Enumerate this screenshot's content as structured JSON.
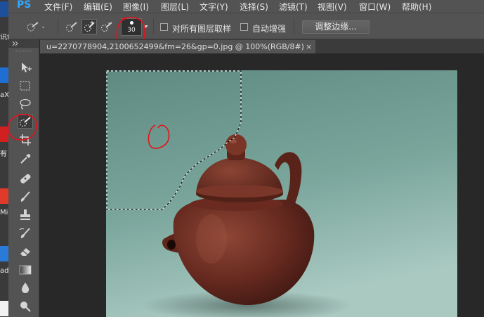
{
  "app": {
    "logo": "PS"
  },
  "desktop_strip": {
    "fragments": [
      "讯f",
      "aX",
      "有",
      "Mi",
      "ad"
    ]
  },
  "menu": {
    "items": [
      "文件(F)",
      "编辑(E)",
      "图像(I)",
      "图层(L)",
      "文字(Y)",
      "选择(S)",
      "滤镜(T)",
      "视图(V)",
      "窗口(W)",
      "帮助(H)"
    ]
  },
  "options": {
    "brush_size": "30",
    "sample_all_layers_label": "对所有图层取样",
    "auto_enhance_label": "自动增强",
    "refine_edge_label": "调整边缘..."
  },
  "document": {
    "tab_title": "u=2270778904,2100652499&fm=26&gp=0.jpg @ 100%(RGB/8#)",
    "close_glyph": "×"
  },
  "tools": {
    "items": [
      "move-tool",
      "marquee-tool",
      "lasso-tool",
      "quick-selection-tool",
      "crop-tool",
      "eyedropper-tool",
      "healing-brush-tool",
      "brush-tool",
      "clone-stamp-tool",
      "history-brush-tool",
      "eraser-tool",
      "gradient-tool",
      "blur-tool",
      "dodge-tool"
    ]
  },
  "colors": {
    "accent": "#31a8ff",
    "annotation": "#e3131b",
    "canvas_background": "#6f9990",
    "teapot": "#6b2c22"
  }
}
